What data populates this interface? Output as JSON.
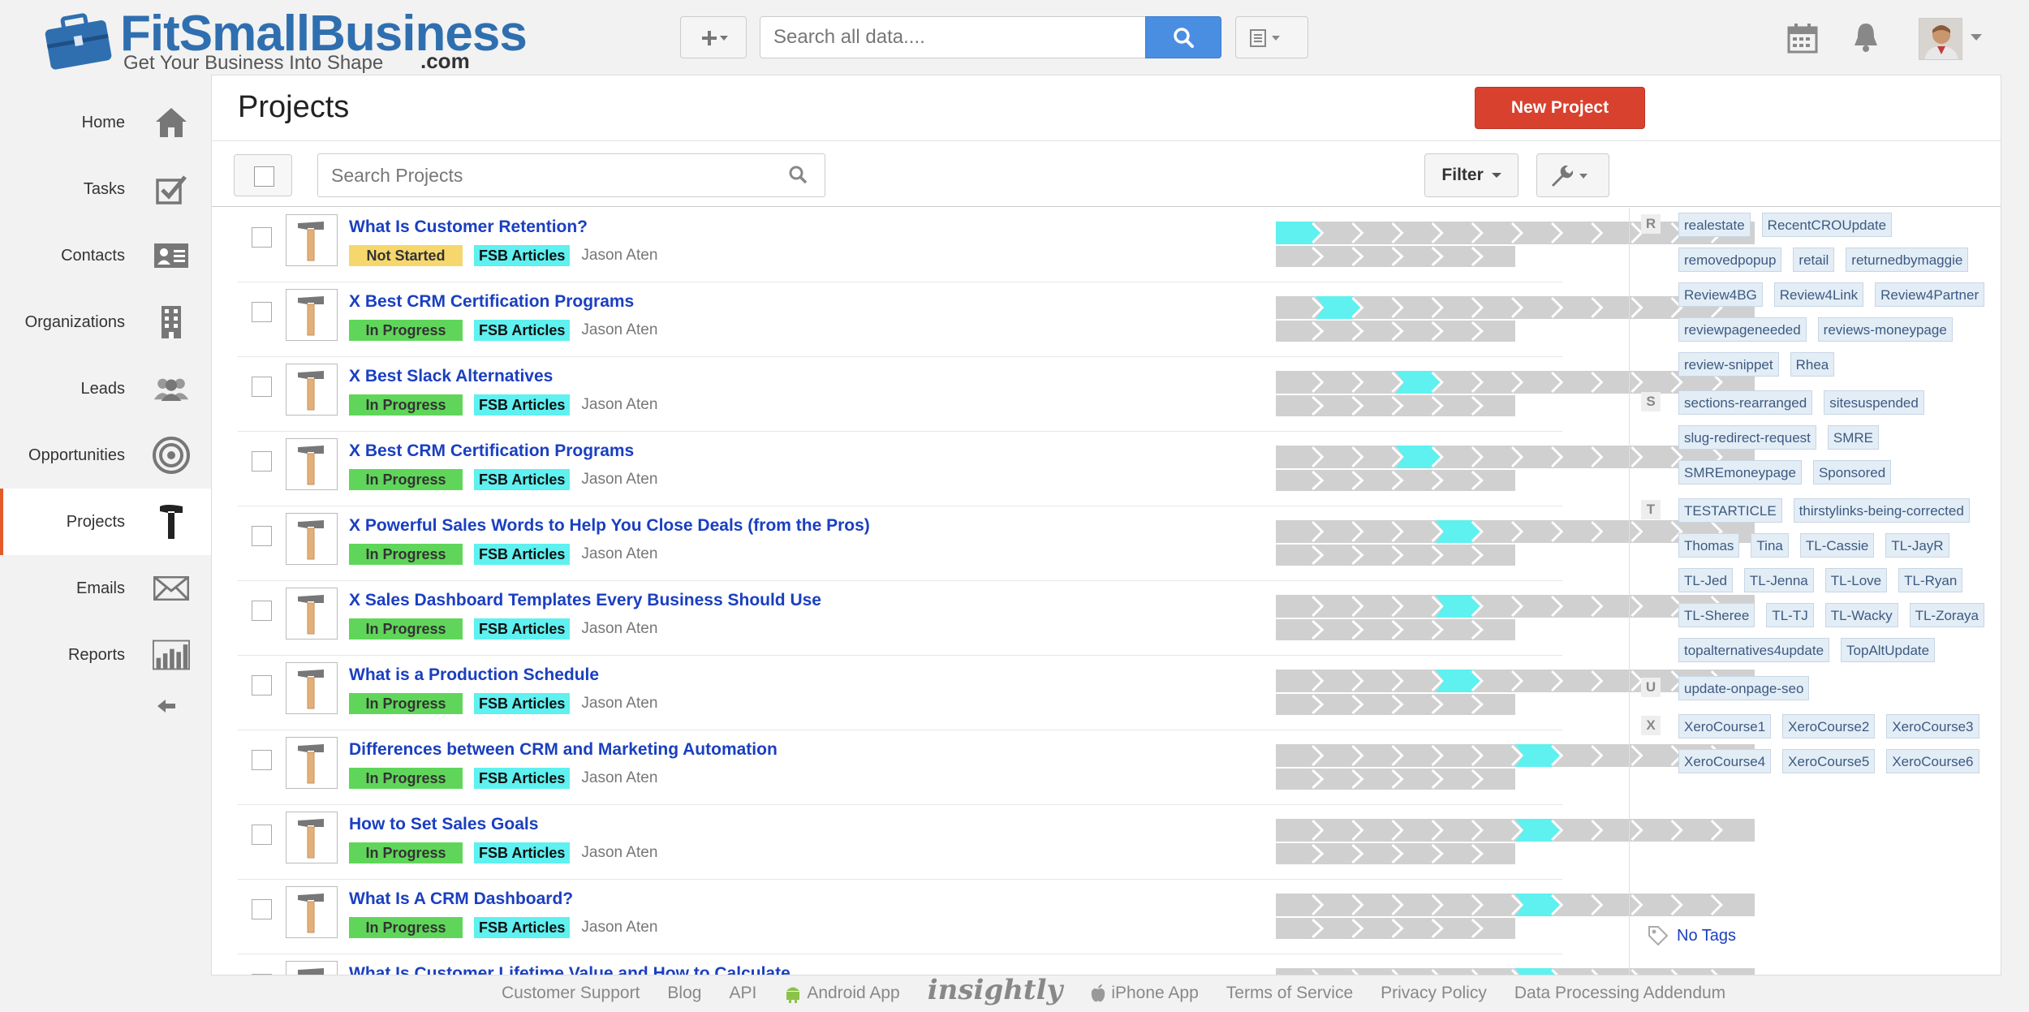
{
  "brand": {
    "name": "FitSmallBusiness",
    "tagline": "Get Your Business Into Shape",
    "domain": ".com"
  },
  "header": {
    "search_placeholder": "Search all data....",
    "add_icon": "plus-icon",
    "search_icon": "magnifier-icon",
    "views_icon": "list-view-icon",
    "calendar_icon": "calendar-icon",
    "notifications_icon": "bell-icon"
  },
  "sidebar": {
    "items": [
      {
        "label": "Home",
        "icon": "home-icon"
      },
      {
        "label": "Tasks",
        "icon": "checkbox-icon"
      },
      {
        "label": "Contacts",
        "icon": "contact-card-icon"
      },
      {
        "label": "Organizations",
        "icon": "building-icon"
      },
      {
        "label": "Leads",
        "icon": "people-icon"
      },
      {
        "label": "Opportunities",
        "icon": "target-icon"
      },
      {
        "label": "Projects",
        "icon": "hammer-icon",
        "active": true
      },
      {
        "label": "Emails",
        "icon": "envelope-icon"
      },
      {
        "label": "Reports",
        "icon": "bar-chart-icon"
      }
    ],
    "collapse_icon": "arrow-left-icon"
  },
  "main": {
    "title": "Projects",
    "new_project_label": "New Project",
    "search_placeholder": "Search Projects",
    "filter_label": "Filter",
    "pipeline_stage_count": 12,
    "projects": [
      {
        "title": "What Is Customer Retention?",
        "status": "Not Started",
        "category": "FSB Articles",
        "owner": "Jason Aten",
        "stage": 1
      },
      {
        "title": "X Best CRM Certification Programs",
        "status": "In Progress",
        "category": "FSB Articles",
        "owner": "Jason Aten",
        "stage": 2
      },
      {
        "title": "X Best Slack Alternatives",
        "status": "In Progress",
        "category": "FSB Articles",
        "owner": "Jason Aten",
        "stage": 4
      },
      {
        "title": "X Best CRM Certification Programs",
        "status": "In Progress",
        "category": "FSB Articles",
        "owner": "Jason Aten",
        "stage": 4
      },
      {
        "title": "X Powerful Sales Words to Help You Close Deals (from the Pros)",
        "status": "In Progress",
        "category": "FSB Articles",
        "owner": "Jason Aten",
        "stage": 5
      },
      {
        "title": "X Sales Dashboard Templates Every Business Should Use",
        "status": "In Progress",
        "category": "FSB Articles",
        "owner": "Jason Aten",
        "stage": 5
      },
      {
        "title": "What is a Production Schedule",
        "status": "In Progress",
        "category": "FSB Articles",
        "owner": "Jason Aten",
        "stage": 5
      },
      {
        "title": "Differences between CRM and Marketing Automation",
        "status": "In Progress",
        "category": "FSB Articles",
        "owner": "Jason Aten",
        "stage": 7
      },
      {
        "title": "How to Set Sales Goals",
        "status": "In Progress",
        "category": "FSB Articles",
        "owner": "Jason Aten",
        "stage": 7
      },
      {
        "title": "What Is A CRM Dashboard?",
        "status": "In Progress",
        "category": "FSB Articles",
        "owner": "Jason Aten",
        "stage": 7
      },
      {
        "title": "What Is Customer Lifetime Value and How to Calculate",
        "status": "",
        "category": "",
        "owner": "",
        "stage": 7
      }
    ]
  },
  "tag_cloud": {
    "groups": [
      {
        "letter": "R",
        "tags": [
          "realestate",
          "RecentCROUpdate",
          "removedpopup",
          "retail",
          "returnedbymaggie",
          "Review4BG",
          "Review4Link",
          "Review4Partner",
          "reviewpageneeded",
          "reviews-moneypage",
          "review-snippet",
          "Rhea"
        ]
      },
      {
        "letter": "S",
        "tags": [
          "sections-rearranged",
          "sitesuspended",
          "slug-redirect-request",
          "SMRE",
          "SMREmoneypage",
          "Sponsored"
        ]
      },
      {
        "letter": "T",
        "tags": [
          "TESTARTICLE",
          "thirstylinks-being-corrected",
          "Thomas",
          "Tina",
          "TL-Cassie",
          "TL-JayR",
          "TL-Jed",
          "TL-Jenna",
          "TL-Love",
          "TL-Ryan",
          "TL-Sheree",
          "TL-TJ",
          "TL-Wacky",
          "TL-Zoraya",
          "topalternatives4update",
          "TopAltUpdate"
        ]
      },
      {
        "letter": "U",
        "tags": [
          "update-onpage-seo"
        ]
      },
      {
        "letter": "X",
        "tags": [
          "XeroCourse1",
          "XeroCourse2",
          "XeroCourse3",
          "XeroCourse4",
          "XeroCourse5",
          "XeroCourse6"
        ]
      }
    ],
    "no_tags_label": "No Tags"
  },
  "footer": {
    "links": [
      "Customer Support",
      "Blog",
      "API",
      "Android App",
      "insightly",
      "iPhone App",
      "Terms of Service",
      "Privacy Policy",
      "Data Processing Addendum"
    ]
  },
  "colors": {
    "accent_blue": "#4a8ee2",
    "new_project_red": "#d9412f",
    "status_in_progress": "#5fd65a",
    "status_not_started": "#f5d76e",
    "category_badge": "#5ff0f0",
    "link_blue": "#1a3fc0",
    "active_marker": "#e55a2b"
  }
}
